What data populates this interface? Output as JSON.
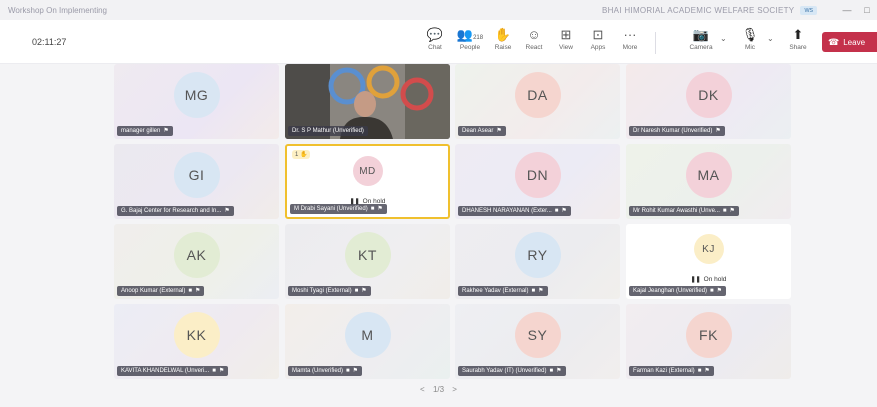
{
  "window": {
    "title": "Workshop On Implementing",
    "org": "BHAI HIMORIAL ACADEMIC WELFARE SOCIETY",
    "signin": "ws",
    "min": "—",
    "restore": "□"
  },
  "toolbar": {
    "timer": "02:11:27",
    "items": [
      {
        "label": "Chat",
        "icon": "chat-icon",
        "glyph": "💬"
      },
      {
        "label": "People",
        "icon": "people-icon",
        "glyph": "👥",
        "count": "218"
      },
      {
        "label": "Raise",
        "icon": "raise-hand-icon",
        "glyph": "✋"
      },
      {
        "label": "React",
        "icon": "react-icon",
        "glyph": "☺"
      },
      {
        "label": "View",
        "icon": "view-grid-icon",
        "glyph": "⊞"
      },
      {
        "label": "Apps",
        "icon": "apps-icon",
        "glyph": "⊡"
      },
      {
        "label": "More",
        "icon": "more-icon",
        "glyph": "···"
      },
      {
        "label": "Camera",
        "icon": "camera-off-icon",
        "glyph": "📷"
      },
      {
        "label": "Mic",
        "icon": "mic-off-icon",
        "glyph": "🎙"
      },
      {
        "label": "Share",
        "icon": "share-icon",
        "glyph": "⬆"
      }
    ],
    "leave_label": "Leave",
    "leave_color": "#c4314b"
  },
  "tiles": [
    {
      "initials": "MG",
      "name": "manager gillen",
      "avatar_color": "#d9e6f3",
      "state": "normal"
    },
    {
      "initials": "",
      "name": "Dr. S P Mathur (Unverified)",
      "avatar_color": "",
      "state": "video"
    },
    {
      "initials": "DA",
      "name": "Dean Asear",
      "avatar_color": "#f5d5cf",
      "state": "normal"
    },
    {
      "initials": "DK",
      "name": "Dr Naresh Kumar (Unverified)",
      "avatar_color": "#f3d1d9",
      "state": "normal"
    },
    {
      "initials": "GI",
      "name": "G. Bajaj Center for Research and In...",
      "avatar_color": "#d8e6f3",
      "state": "normal"
    },
    {
      "initials": "MD",
      "name": "M Drabi Sayani (Unverified)",
      "avatar_color": "#f3d1d9",
      "state": "hold",
      "hold_label": "On hold",
      "raise": "1 ✋"
    },
    {
      "initials": "DN",
      "name": "DHANESH NARAYANAN (Exter...",
      "avatar_color": "#f3d1d9",
      "state": "normal"
    },
    {
      "initials": "MA",
      "name": "Mr Rohit Kumar Awasthi (Unve...",
      "avatar_color": "#f3d1d9",
      "state": "normal"
    },
    {
      "initials": "AK",
      "name": "Anoop Kumar (External)",
      "avatar_color": "#e2ecd4",
      "state": "normal"
    },
    {
      "initials": "KT",
      "name": "Moshi Tyagi (External)",
      "avatar_color": "#e2ecd4",
      "state": "normal"
    },
    {
      "initials": "RY",
      "name": "Rakhee Yadav (External)",
      "avatar_color": "#d8e6f3",
      "state": "normal"
    },
    {
      "initials": "KJ",
      "name": "Kajal Jeanghan (Unverified)",
      "avatar_color": "#fbeec7",
      "state": "hold",
      "hold_label": "On hold"
    },
    {
      "initials": "KK",
      "name": "KAVITA KHANDELWAL (Unveri...",
      "avatar_color": "#fbeec7",
      "state": "normal"
    },
    {
      "initials": "M",
      "name": "Mamta (Unverified)",
      "avatar_color": "#d8e6f3",
      "state": "normal"
    },
    {
      "initials": "SY",
      "name": "Saurabh Yadav (IT) (Unverified)",
      "avatar_color": "#f5d5cf",
      "state": "normal"
    },
    {
      "initials": "FK",
      "name": "Farman Kazi (External)",
      "avatar_color": "#f5d5cf",
      "state": "normal"
    }
  ],
  "pager": {
    "prev": "<",
    "page": "1/3",
    "next": ">"
  }
}
